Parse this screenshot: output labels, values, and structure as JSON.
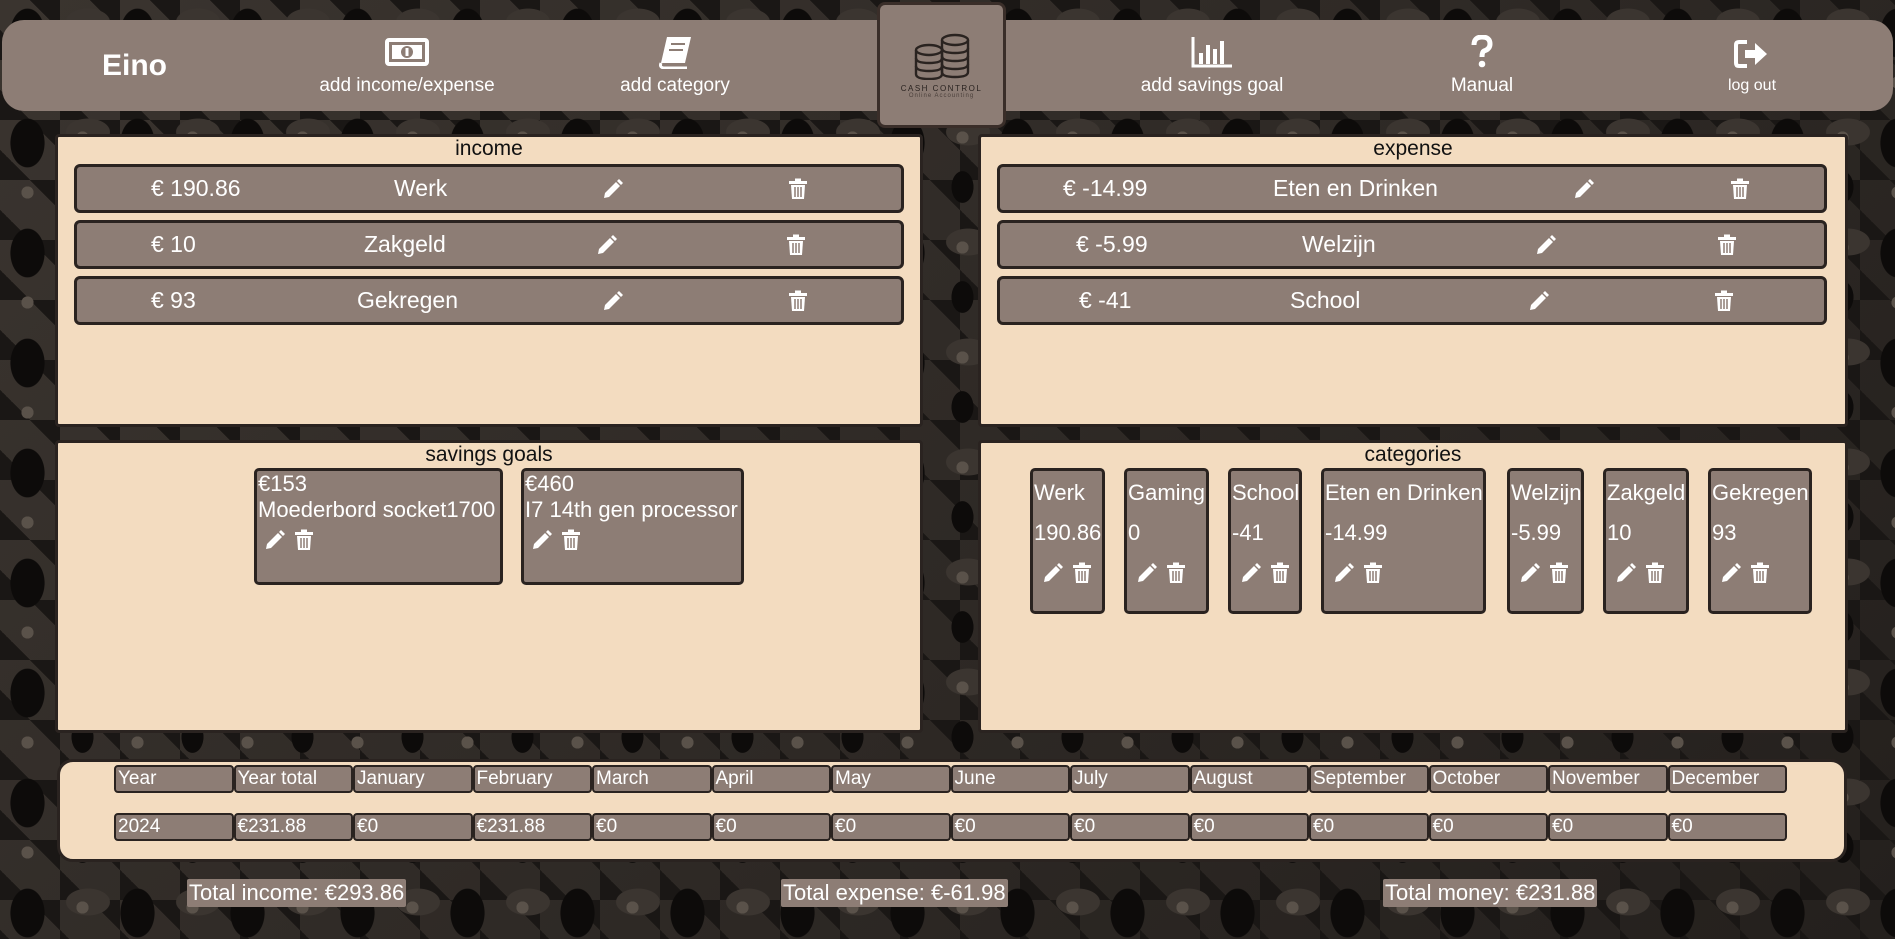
{
  "navbar": {
    "username": "Eino",
    "add_income_expense": "add income/expense",
    "add_category": "add category",
    "logo_text": "CASH CONTROL",
    "logo_sub": "Online Accounting",
    "add_savings_goal": "add savings goal",
    "manual": "Manual",
    "log_out": "log out"
  },
  "income": {
    "title": "income",
    "rows": [
      {
        "amount": "€ 190.86",
        "category": "Werk"
      },
      {
        "amount": "€ 10",
        "category": "Zakgeld"
      },
      {
        "amount": "€ 93",
        "category": "Gekregen"
      }
    ]
  },
  "expense": {
    "title": "expense",
    "rows": [
      {
        "amount": "€ -14.99",
        "category": "Eten en Drinken"
      },
      {
        "amount": "€ -5.99",
        "category": "Welzijn"
      },
      {
        "amount": "€ -41",
        "category": "School"
      }
    ]
  },
  "savings_goals": {
    "title": "savings goals",
    "goals": [
      {
        "amount": "€153",
        "name": "Moederbord socket1700"
      },
      {
        "amount": "€460",
        "name": "I7 14th gen processor"
      }
    ]
  },
  "categories": {
    "title": "categories",
    "items": [
      {
        "name": "Werk",
        "value": "190.86"
      },
      {
        "name": "Gaming",
        "value": "0"
      },
      {
        "name": "School",
        "value": "-41"
      },
      {
        "name": "Eten en Drinken",
        "value": "-14.99"
      },
      {
        "name": "Welzijn",
        "value": "-5.99"
      },
      {
        "name": "Zakgeld",
        "value": "10"
      },
      {
        "name": "Gekregen",
        "value": "93"
      }
    ]
  },
  "overview": {
    "headers": [
      "Year",
      "Year total",
      "January",
      "February",
      "March",
      "April",
      "May",
      "June",
      "July",
      "August",
      "September",
      "October",
      "November",
      "December"
    ],
    "row": [
      "2024",
      "€231.88",
      "€0",
      "€231.88",
      "€0",
      "€0",
      "€0",
      "€0",
      "€0",
      "€0",
      "€0",
      "€0",
      "€0",
      "€0"
    ]
  },
  "totals": {
    "income": "Total income: €293.86",
    "expense": "Total expense: €-61.98",
    "money": "Total money: €231.88"
  }
}
